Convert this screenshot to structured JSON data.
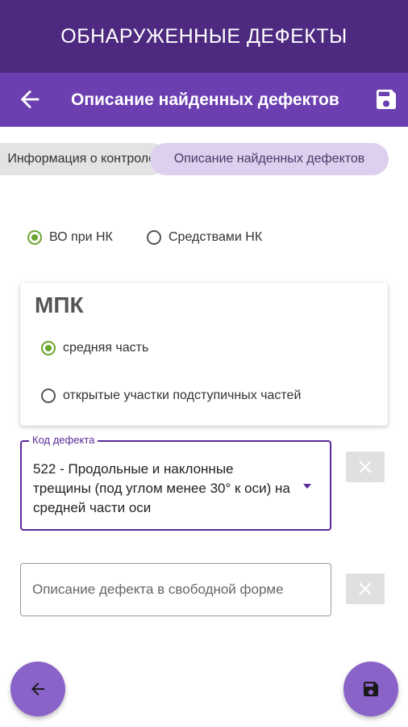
{
  "app_header": {
    "title": "ОБНАРУЖЕННЫЕ ДЕФЕКТЫ"
  },
  "toolbar": {
    "title": "Описание найденных дефектов",
    "back_icon": "arrow-left-icon",
    "save_icon": "floppy-disk-icon"
  },
  "tabs": [
    {
      "label": "Информация о контроле",
      "selected": false
    },
    {
      "label": "Описание найденных дефектов",
      "selected": true
    }
  ],
  "method": {
    "options": [
      {
        "label": "ВО при НК",
        "selected": true
      },
      {
        "label": "Средствами НК",
        "selected": false
      }
    ]
  },
  "mpk_card": {
    "title": "МПК",
    "options": [
      {
        "label": "средняя часть",
        "selected": true
      },
      {
        "label": "открытые участки подступичных частей",
        "selected": false
      }
    ]
  },
  "defect_code": {
    "label": "Код дефекта",
    "value": "522 - Продольные и наклонные трещины (под углом менее 30° к оси) на средней части оси"
  },
  "free_description": {
    "placeholder": "Описание дефекта в свободной форме",
    "value": ""
  },
  "colors": {
    "header_bg": "#4d2a80",
    "toolbar_bg": "#6b3fb0",
    "accent": "#6aa52f",
    "fab_bg": "#8a63c9",
    "chip_selected_bg": "#ddd0ef"
  },
  "fabs": {
    "back_icon": "arrow-left-icon",
    "save_icon": "floppy-disk-icon"
  }
}
